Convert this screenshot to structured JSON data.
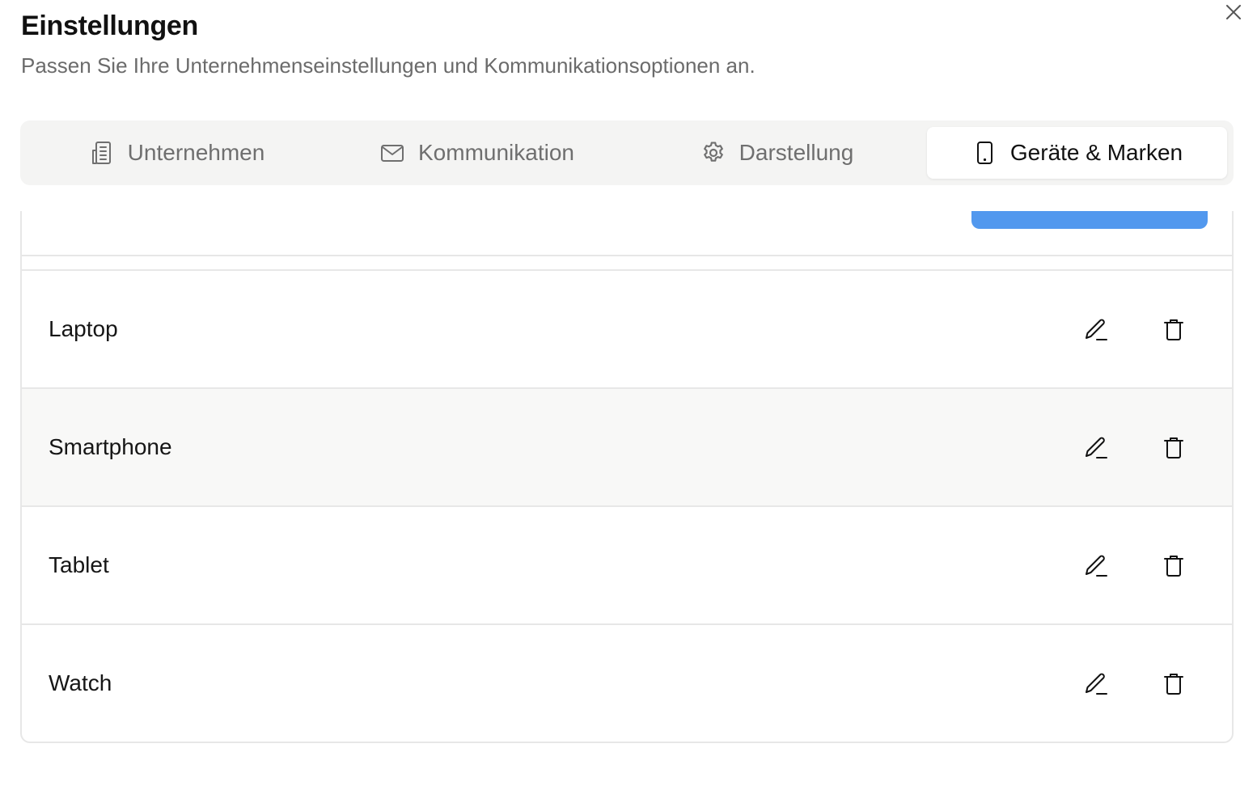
{
  "dialog": {
    "title": "Einstellungen",
    "subtitle": "Passen Sie Ihre Unternehmenseinstellungen und Kommunikationsoptionen an.",
    "close_icon": "close-icon"
  },
  "tabs": [
    {
      "label": "Unternehmen",
      "icon": "building-icon",
      "active": false
    },
    {
      "label": "Kommunikation",
      "icon": "mail-icon",
      "active": false
    },
    {
      "label": "Darstellung",
      "icon": "gear-icon",
      "active": false
    },
    {
      "label": "Geräte & Marken",
      "icon": "tablet-icon",
      "active": true
    }
  ],
  "colors": {
    "accent_button": "#5298ee",
    "tab_bar_background": "#f4f4f3",
    "border": "#e7e7e7",
    "row_highlight": "#f8f8f7"
  },
  "devices": {
    "items": [
      {
        "label": "Laptop",
        "edit_icon": "pencil-icon",
        "delete_icon": "trash-icon"
      },
      {
        "label": "Smartphone",
        "edit_icon": "pencil-icon",
        "delete_icon": "trash-icon"
      },
      {
        "label": "Tablet",
        "edit_icon": "pencil-icon",
        "delete_icon": "trash-icon"
      },
      {
        "label": "Watch",
        "edit_icon": "pencil-icon",
        "delete_icon": "trash-icon"
      }
    ]
  }
}
